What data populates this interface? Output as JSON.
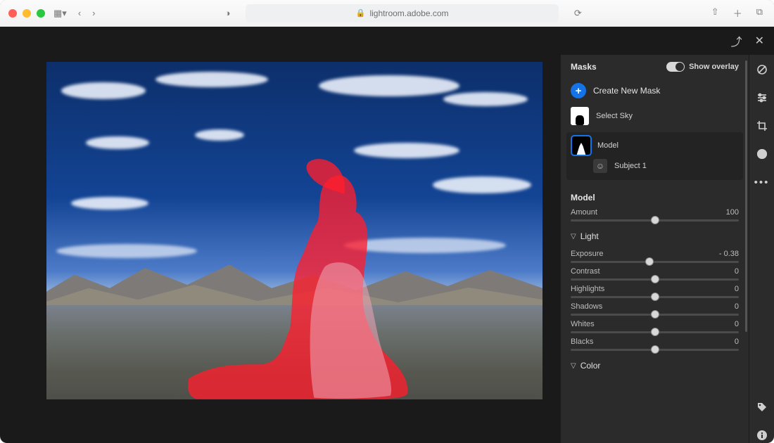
{
  "browser": {
    "url": "lightroom.adobe.com"
  },
  "topbar": {},
  "panel": {
    "title": "Masks",
    "overlay_label": "Show overlay",
    "create_label": "Create New Mask",
    "masks": [
      {
        "label": "Select Sky"
      },
      {
        "label": "Model",
        "sub": "Subject 1"
      }
    ],
    "selected_name": "Model",
    "amount": {
      "label": "Amount",
      "value": "100"
    },
    "light_label": "Light",
    "sliders": [
      {
        "label": "Exposure",
        "value": "- 0.38",
        "pos": 47
      },
      {
        "label": "Contrast",
        "value": "0",
        "pos": 50
      },
      {
        "label": "Highlights",
        "value": "0",
        "pos": 50
      },
      {
        "label": "Shadows",
        "value": "0",
        "pos": 50
      },
      {
        "label": "Whites",
        "value": "0",
        "pos": 50
      },
      {
        "label": "Blacks",
        "value": "0",
        "pos": 50
      }
    ],
    "color_label": "Color"
  }
}
